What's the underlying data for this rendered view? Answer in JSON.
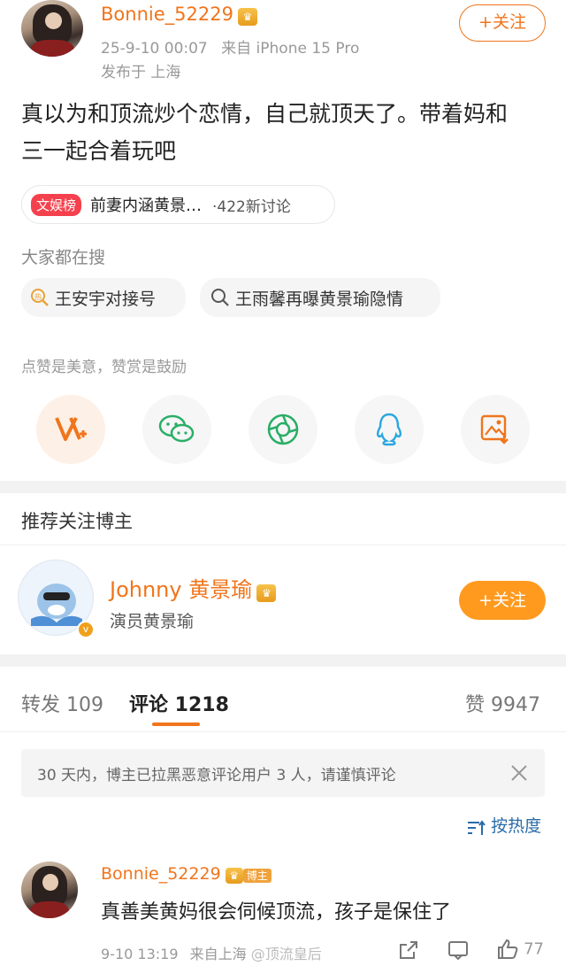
{
  "post": {
    "username": "Bonnie_52229",
    "time": "25-9-10 00:07",
    "source": "来自 iPhone 15 Pro",
    "location": "发布于 上海",
    "follow_label": "+关注",
    "content_line1": "真以为和顶流炒个恋情，自己就顶天了。带着妈和",
    "content_line2": "三一起合着玩吧"
  },
  "topic": {
    "badge": "文娱榜",
    "text": "前妻内涵黄景…",
    "count": "·422新讨论"
  },
  "search": {
    "label": "大家都在搜",
    "items": [
      {
        "icon": "hot-search-icon",
        "text": "王安宇对接号"
      },
      {
        "icon": "search-icon",
        "text": "王雨馨再曝黄景瑜隐情"
      }
    ]
  },
  "encourage": {
    "label": "点赞是美意，赞赏是鼓励"
  },
  "share_icons": [
    "v-plus-icon",
    "wechat-icon",
    "moments-icon",
    "qq-icon",
    "save-image-icon"
  ],
  "recommend": {
    "title": "推荐关注博主",
    "name": "Johnny 黄景瑜",
    "subtitle": "演员黄景瑜",
    "follow_label": "+关注"
  },
  "tabs": {
    "repost": "转发 109",
    "comment": "评论 1218",
    "like": "赞 9947"
  },
  "notice": "30 天内，博主已拉黑恶意评论用户 3 人，请谨慎评论",
  "sort_label": "按热度",
  "comment": {
    "username": "Bonnie_52229",
    "badge": "博主",
    "text": "真善美黄妈很会伺候顶流，孩子是保住了",
    "time": "9-10 13:19",
    "source": "来自上海",
    "watermark": "@顶流皇后",
    "likes": "77"
  },
  "colors": {
    "accent": "#f0751c",
    "follow_button": "#ff9a1f",
    "link_blue": "#2a6ca8"
  }
}
